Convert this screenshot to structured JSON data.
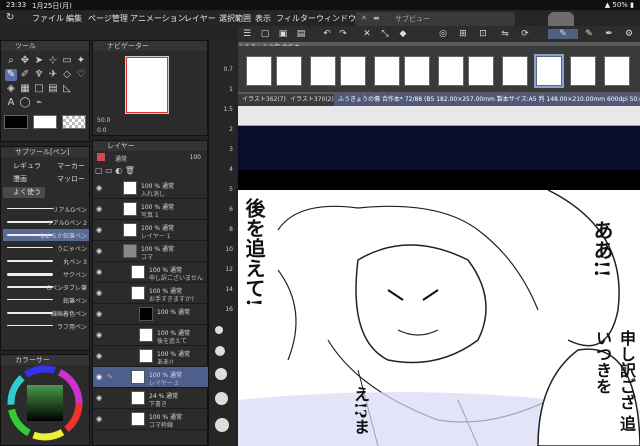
{
  "status": {
    "time": "23:33",
    "date": "1月25日(月)",
    "battery": "50%"
  },
  "menu": {
    "items": [
      "ファイル",
      "編集",
      "ページ管理",
      "アニメーション",
      "レイヤー",
      "選択範囲",
      "表示",
      "フィルター",
      "ウィンドウ"
    ]
  },
  "subview": {
    "title": "サブビュー"
  },
  "tool_panel": {
    "title": "ツール"
  },
  "subtool_panel": {
    "title": "サブツール[ペン]",
    "tabs": [
      "レギュラー",
      "マーカー",
      "漫画",
      "マッロー",
      "よく使う"
    ],
    "brushes": [
      "リアルGペン",
      "リアルGペン 2",
      "なめらか鉛筆ペン",
      "うにゃペン",
      "丸ペン 3",
      "サクペン",
      "Gペンタブレ筆",
      "鉛筆ペン",
      "線画着色ペン",
      "ラフ用ペン"
    ]
  },
  "color_panel": {
    "title": "カラーサー"
  },
  "navigator": {
    "title": "ナビゲーター",
    "zoom": "50.0",
    "rotate": "0.0"
  },
  "layer_panel": {
    "title": "レイヤー",
    "blend": "通常",
    "opacity": "100",
    "layers": [
      {
        "name": "100 % 通常",
        "sub": "入れ消し"
      },
      {
        "name": "100 % 通常",
        "sub": "写真 1"
      },
      {
        "name": "100 % 通常",
        "sub": "レイヤー 1"
      },
      {
        "name": "100 % 通常",
        "sub": "コマ"
      },
      {
        "name": "100 % 通常",
        "sub": "申し訳ございません"
      },
      {
        "name": "100 % 通常",
        "sub": "お手すきますか?"
      },
      {
        "name": "100 % 通常",
        "sub": ""
      },
      {
        "name": "100 % 通常",
        "sub": "後を追えて"
      },
      {
        "name": "100 % 通常",
        "sub": "ああ!!"
      },
      {
        "name": "100 % 通常",
        "sub": "レイヤー 2"
      },
      {
        "name": "24 % 通常",
        "sub": "下書き"
      },
      {
        "name": "100 % 通常",
        "sub": "コマ枠線"
      }
    ]
  },
  "zoom_column": {
    "ticks": [
      "0.7",
      "1",
      "1.5",
      "2",
      "3",
      "4",
      "5",
      "6",
      "8",
      "10",
      "12",
      "14",
      "16"
    ]
  },
  "document_tabs": [
    {
      "label": "イラスト362(7)"
    },
    {
      "label": "イラスト370(2)"
    },
    {
      "label": "ふうきょうの傷 合作本* 72/88 (B5 182.00×257.00mm 製本サイズ:A5 判 148.00×210.00mm 600dpi 50.0%)"
    }
  ],
  "page_manager_title": "ふうきょうの傷 合作本",
  "manga": {
    "bubble_right": "ああ!!",
    "bubble_bottom_right": "申し訳ござ 追いつきを",
    "left_text": "後を追えて!",
    "bottom_center": "え!?ま"
  }
}
